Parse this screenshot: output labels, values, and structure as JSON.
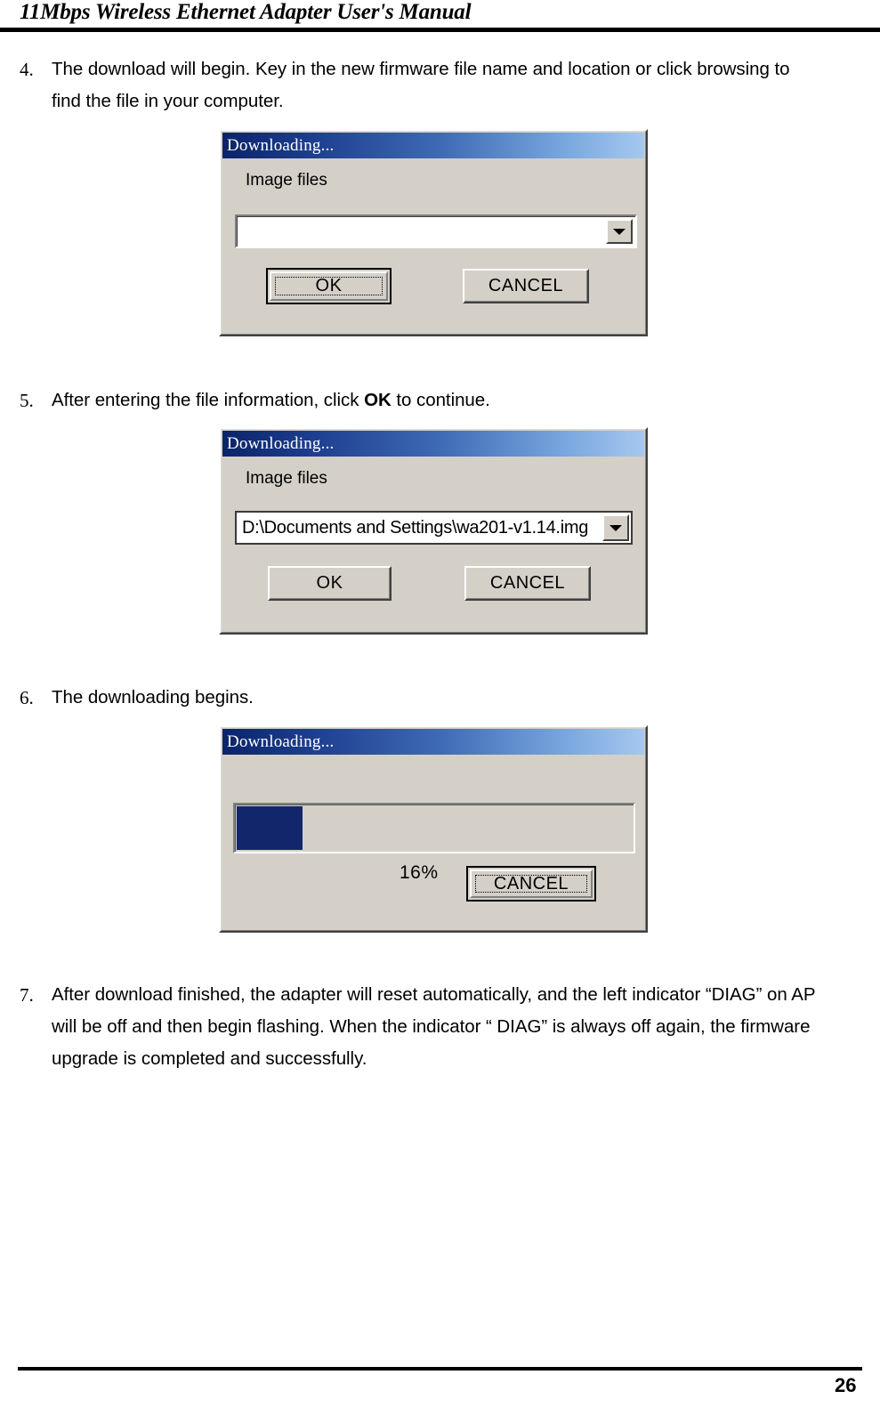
{
  "header": {
    "title": "11Mbps Wireless Ethernet Adapter User's Manual"
  },
  "footer": {
    "page_number": "26"
  },
  "steps": [
    {
      "number": "4.",
      "text_before_bold": "The download will begin. Key in the new firmware file name and location or click browsing to find the file in your computer.",
      "bold": "",
      "text_after_bold": ""
    },
    {
      "number": "5.",
      "text_before_bold": "After entering the file information, click ",
      "bold": "OK",
      "text_after_bold": " to continue."
    },
    {
      "number": "6.",
      "text_before_bold": "The downloading begins.",
      "bold": "",
      "text_after_bold": ""
    },
    {
      "number": "7.",
      "text_before_bold": "After download finished, the adapter will reset automatically, and the left indicator “DIAG” on AP will be off and then begin flashing. When the indicator “ DIAG” is always off again, the firmware upgrade is completed and successfully.",
      "bold": "",
      "text_after_bold": ""
    }
  ],
  "dialog_empty": {
    "title": "Downloading...",
    "field_label": "Image files",
    "combo_value": "",
    "combo_arrow_icon": "chevron-down-icon",
    "ok_label": "OK",
    "cancel_label": "CANCEL",
    "default_button": "ok"
  },
  "dialog_filled": {
    "title": "Downloading...",
    "field_label": "Image files",
    "combo_value": "D:\\Documents and Settings\\wa201-v1.14.img",
    "combo_arrow_icon": "chevron-down-icon",
    "ok_label": "OK",
    "cancel_label": "CANCEL",
    "default_button": "none"
  },
  "dialog_progress": {
    "title": "Downloading...",
    "percent_label": "16%",
    "percent_value": 16,
    "progress_fill_color": "#12276b",
    "cancel_label": "CANCEL",
    "default_button": "cancel"
  },
  "colors": {
    "dialog_face": "#d4d0c8",
    "titlebar_start": "#0a246a",
    "titlebar_end": "#a6c8ee",
    "progress_fill": "#12276b"
  }
}
